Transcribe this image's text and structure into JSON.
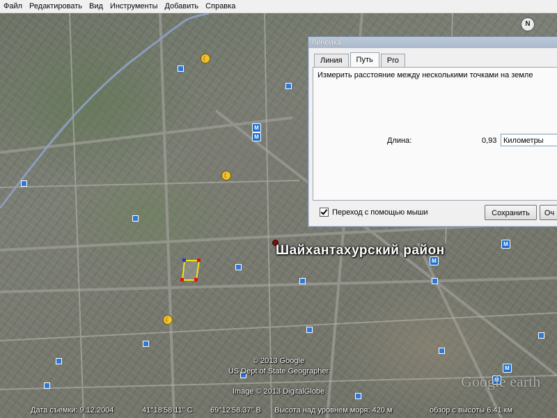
{
  "menu": [
    "Файл",
    "Редактировать",
    "Вид",
    "Инструменты",
    "Добавить",
    "Справка"
  ],
  "compass_label": "N",
  "ruler": {
    "title": "Линейка",
    "tabs": [
      "Линия",
      "Путь",
      "Pro"
    ],
    "active_tab": "Путь",
    "description": "Измерить расстояние между несколькими точками на земле",
    "length_label": "Длина:",
    "length_value": "0,93",
    "unit": "Километры",
    "mouse_nav_label": "Переход с помощью мыши",
    "save_label": "Сохранить",
    "clear_label": "Оч"
  },
  "map": {
    "place_name": "Шайхантахурский район",
    "copyright_lines": [
      "© 2013 Google",
      "US Dept of State Geographer"
    ],
    "image_credit": "Image © 2013 DigitalGlobe",
    "logo_text": "Google earth"
  },
  "status": {
    "date": "Дата съемки: 9.12.2004",
    "lat": "41°18'58.11\" С",
    "lon": "69°12'58.37\" В",
    "elevation": "Высота над уровнем моря:  420 м",
    "eye_alt": "обзор с высоты  6.41 км"
  }
}
